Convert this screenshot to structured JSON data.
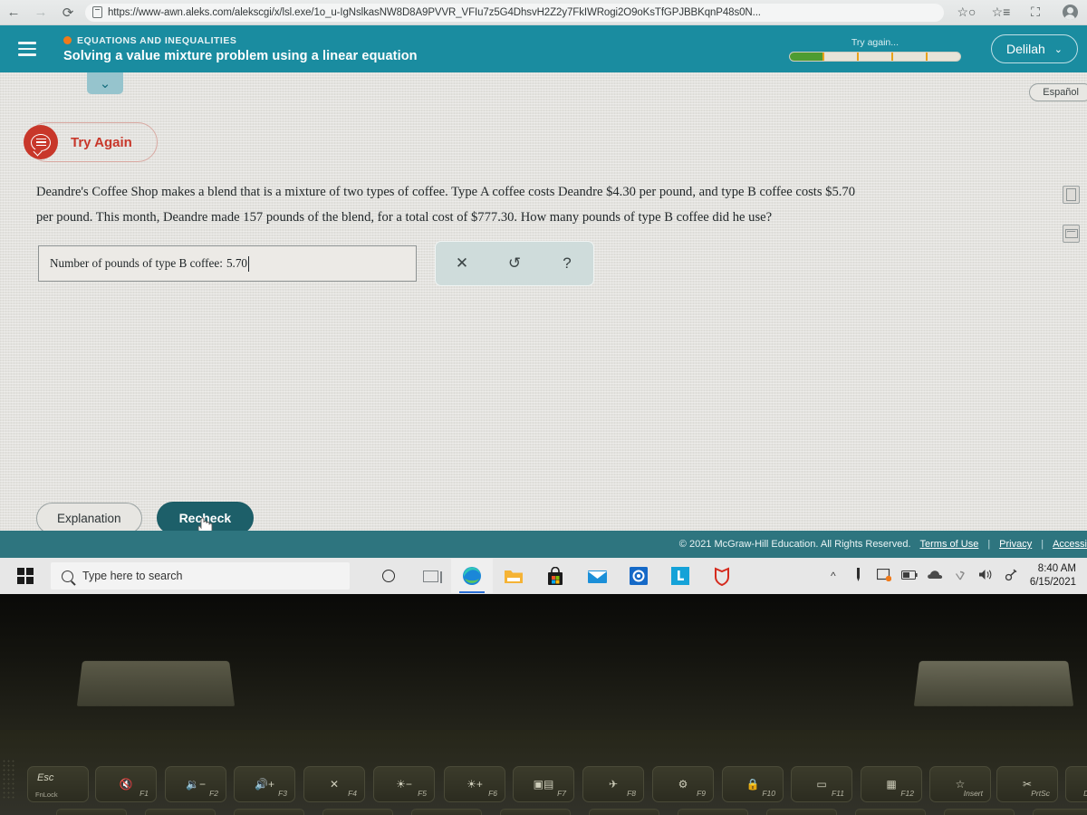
{
  "browser": {
    "back_icon": "back-arrow-icon",
    "forward_icon": "forward-arrow-icon",
    "reload_icon": "reload-icon",
    "url": "https://www-awn.aleks.com/alekscgi/x/lsl.exe/1o_u-IgNslkasNW8D8A9PVVR_VFIu7z5G4DhsvH2Z2y7FkIWRogi2O9oKsTfGPJBBKqnP48s0N...",
    "collections_icon": "collections-icon",
    "favorites_icon": "favorites-icon",
    "add_tab_icon": "add-to-collection-icon",
    "profile_icon": "profile-avatar-icon"
  },
  "header": {
    "topic": "EQUATIONS AND INEQUALITIES",
    "lesson_title": "Solving a value mixture problem using a linear equation",
    "progress_status": "Try again...",
    "progress_segments": 5,
    "progress_completed": 1,
    "user_name": "Delilah",
    "user_chevron": "⌄",
    "teal": "#1a8ca0",
    "accent_orange": "#f07a1a",
    "progress_green": "#4e9c31"
  },
  "page": {
    "collapse_chevron": "⌄",
    "espanol_label": "Español",
    "feedback_badge": "Try Again",
    "feedback_color": "#c8372a",
    "problem_line1": "Deandre's Coffee Shop makes a blend that is a mixture of two types of coffee. Type A coffee costs Deandre $4.30 per pound, and type B coffee costs $5.70",
    "problem_line2": "per pound. This month, Deandre made 157 pounds of the blend, for a total cost of $777.30. How many pounds of type B coffee did he use?",
    "answer_label": "Number of pounds of type B coffee:",
    "answer_value": "5.70",
    "tools": [
      {
        "name": "clear-tool",
        "glyph": "✕"
      },
      {
        "name": "undo-tool",
        "glyph": "↺"
      },
      {
        "name": "help-tool",
        "glyph": "?"
      }
    ],
    "rail": [
      {
        "name": "calculator-icon"
      },
      {
        "name": "message-icon"
      }
    ],
    "explanation_label": "Explanation",
    "recheck_label": "Recheck"
  },
  "footer": {
    "copyright": "© 2021 McGraw-Hill Education. All Rights Reserved.",
    "links": [
      "Terms of Use",
      "Privacy",
      "Accessi"
    ],
    "separator": "|"
  },
  "taskbar": {
    "start_icon": "windows-start-icon",
    "search_placeholder": "Type here to search",
    "cortana_icon": "cortana-icon",
    "taskview_icon": "task-view-icon",
    "apps": [
      {
        "name": "edge-icon",
        "label": "Microsoft Edge"
      },
      {
        "name": "file-explorer-icon",
        "label": "File Explorer"
      },
      {
        "name": "microsoft-store-icon",
        "label": "Microsoft Store"
      },
      {
        "name": "mail-icon",
        "label": "Mail"
      },
      {
        "name": "outlook-icon",
        "label": "Outlook"
      },
      {
        "name": "lenovo-vantage-icon",
        "label": "L"
      },
      {
        "name": "mcafee-shield-icon",
        "label": "McAfee"
      }
    ],
    "tray": [
      {
        "name": "show-hidden-icons-chevron",
        "glyph": "˄"
      },
      {
        "name": "pen-device-icon",
        "glyph": ""
      },
      {
        "name": "notification-icon",
        "glyph": ""
      },
      {
        "name": "battery-icon",
        "glyph": ""
      },
      {
        "name": "onedrive-cloud-icon",
        "glyph": ""
      },
      {
        "name": "wifi-icon",
        "glyph": ""
      },
      {
        "name": "volume-icon",
        "glyph": "⏵"
      },
      {
        "name": "bluetooth-icon",
        "glyph": ""
      }
    ],
    "time": "8:40 AM",
    "date": "6/15/2021"
  },
  "keyboard": {
    "keys": [
      {
        "name": "esc-key",
        "main": "Esc",
        "sub": "FnLock",
        "fl": "",
        "glyph": ""
      },
      {
        "name": "f1-key-mute",
        "fl": "F1",
        "glyph": "🔇"
      },
      {
        "name": "f2-key-volume-down",
        "fl": "F2",
        "glyph": "🔉−"
      },
      {
        "name": "f3-key-volume-up",
        "fl": "F3",
        "glyph": "🔊+"
      },
      {
        "name": "f4-key-mic-mute",
        "fl": "F4",
        "glyph": "✕"
      },
      {
        "name": "f5-key-brightness-down",
        "fl": "F5",
        "glyph": "☀−"
      },
      {
        "name": "f6-key-brightness-up",
        "fl": "F6",
        "glyph": "☀+"
      },
      {
        "name": "f7-key-display-switch",
        "fl": "F7",
        "glyph": "▣▤"
      },
      {
        "name": "f8-key-airplane-mode",
        "fl": "F8",
        "glyph": "✈"
      },
      {
        "name": "f9-key-settings",
        "fl": "F9",
        "glyph": "⚙"
      },
      {
        "name": "f10-key-lock",
        "fl": "F10",
        "glyph": "🔒"
      },
      {
        "name": "f11-key-app-switch",
        "fl": "F11",
        "glyph": "▭"
      },
      {
        "name": "f12-key-calculator",
        "fl": "F12",
        "glyph": "▦"
      },
      {
        "name": "insert-key",
        "fl": "Insert",
        "glyph": "☆"
      },
      {
        "name": "prtsc-key",
        "fl": "PrtSc",
        "glyph": "✂"
      },
      {
        "name": "delete-key",
        "fl": "De",
        "glyph": ""
      }
    ]
  }
}
